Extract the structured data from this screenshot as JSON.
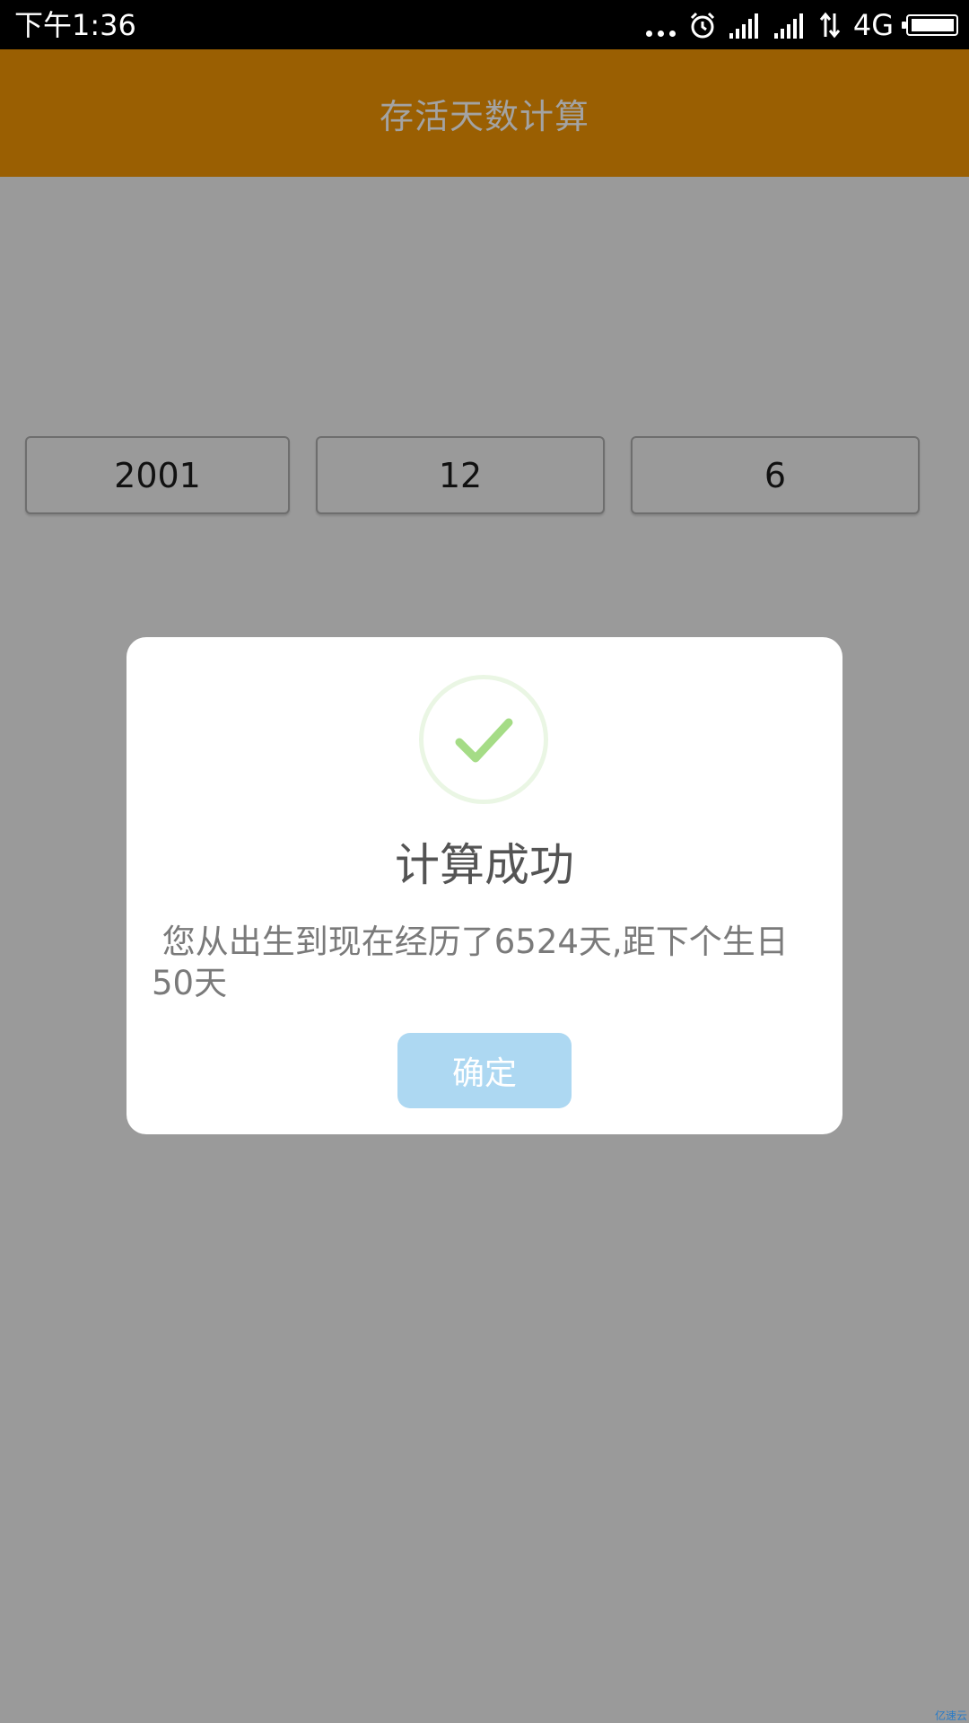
{
  "status_bar": {
    "time": "下午1:36",
    "network": "4G",
    "icons": [
      "more-dots-icon",
      "alarm-icon",
      "signal-icon",
      "signal-icon",
      "data-arrows-icon",
      "battery-icon"
    ]
  },
  "app_bar": {
    "title": "存活天数计算",
    "color": "#9a5f02"
  },
  "form": {
    "year": "2001",
    "month": "12",
    "day": "6"
  },
  "dialog": {
    "icon": "success-check-icon",
    "title": "计算成功",
    "message": " 您从出生到现在经历了6524天,距下个生日50天",
    "confirm_label": "确定",
    "accent": "#add8f2",
    "check_color": "#a5dc86"
  },
  "watermark": "亿速云"
}
